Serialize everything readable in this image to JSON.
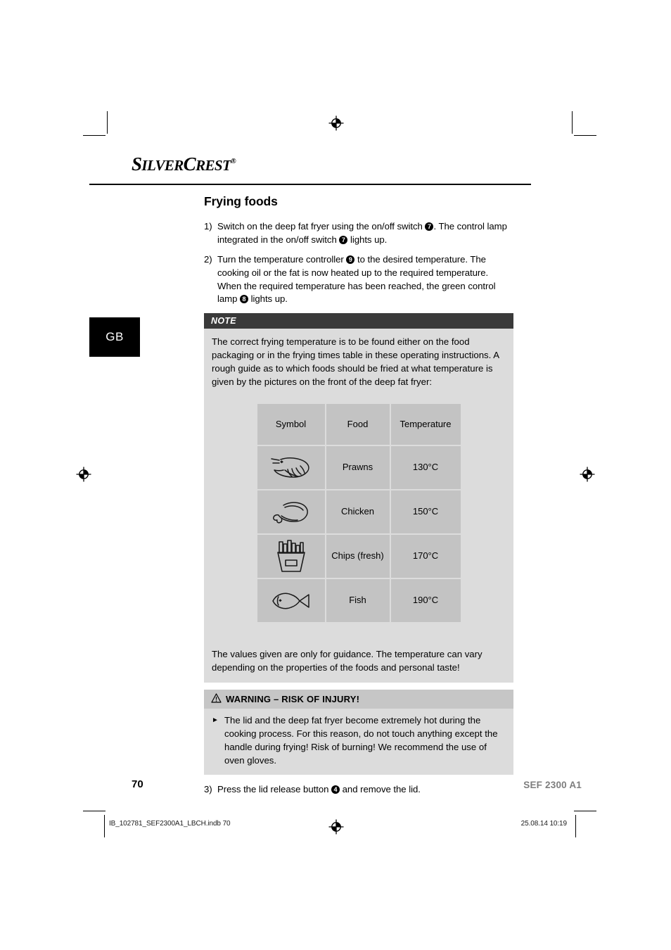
{
  "brand": {
    "name_part1": "S",
    "name_part2": "ILVER",
    "name_part3": "C",
    "name_part4": "REST",
    "registered": "®"
  },
  "language_tab": {
    "label": "GB"
  },
  "page": {
    "title": "Frying foods",
    "steps": [
      {
        "num": "1)",
        "segments": [
          {
            "type": "text",
            "value": "Switch on the deep fat fryer using the on/off switch "
          },
          {
            "type": "callout",
            "value": "7"
          },
          {
            "type": "text",
            "value": ". The control lamp integrated in the on/off switch "
          },
          {
            "type": "callout",
            "value": "7"
          },
          {
            "type": "text",
            "value": " lights up."
          }
        ]
      },
      {
        "num": "2)",
        "segments": [
          {
            "type": "text",
            "value": "Turn the temperature controller "
          },
          {
            "type": "callout",
            "value": "9"
          },
          {
            "type": "text",
            "value": " to the desired temperature. The cooking oil or the fat is now heated up to the required temperature. When the required temperature has been reached, the green control lamp "
          },
          {
            "type": "callout",
            "value": "8"
          },
          {
            "type": "text",
            "value": " lights up."
          }
        ]
      }
    ],
    "step_last": {
      "num": "3)",
      "segments": [
        {
          "type": "text",
          "value": "Press the lid release button "
        },
        {
          "type": "callout",
          "value": "4"
        },
        {
          "type": "text",
          "value": " and remove the lid."
        }
      ]
    }
  },
  "note": {
    "heading": "NOTE",
    "body": "The correct frying temperature is to be found either on the food packaging or in the frying times table in these operating instructions. A rough guide as to which foods should be fried at what temperature is given by the pictures on the front of the deep fat fryer:",
    "footer": "The values given are only for guidance. The temperature can vary depending on the properties of the foods and personal taste!"
  },
  "symbol_table": {
    "headers": [
      "Symbol",
      "Food",
      "Temperature"
    ],
    "rows": [
      {
        "icon": "prawn-icon",
        "food": "Prawns",
        "temperature": "130°C"
      },
      {
        "icon": "chicken-icon",
        "food": "Chicken",
        "temperature": "150°C"
      },
      {
        "icon": "chips-icon",
        "food": "Chips (fresh)",
        "temperature": "170°C"
      },
      {
        "icon": "fish-icon",
        "food": "Fish",
        "temperature": "190°C"
      }
    ]
  },
  "warning": {
    "heading": "WARNING – RISK OF INJURY!",
    "bullet_marker": "►",
    "body": "The lid and the deep fat fryer become extremely hot during the cooking process. For this reason, do not touch anything except the handle during frying! Risk of burning! We recommend the use of oven gloves."
  },
  "footer": {
    "page_number": "70",
    "model": "SEF 2300 A1"
  },
  "printbar": {
    "file": "IB_102781_SEF2300A1_LBCH.indb   70",
    "datetime": "25.08.14   10:19"
  },
  "colors": {
    "note_header_bg": "#3a3a3a",
    "note_body_bg": "#dcdcdc",
    "table_cell_bg": "#c3c3c3",
    "warning_header_bg": "#c6c6c6",
    "model_text": "#7d7d7d",
    "tab_bg": "#000000"
  }
}
